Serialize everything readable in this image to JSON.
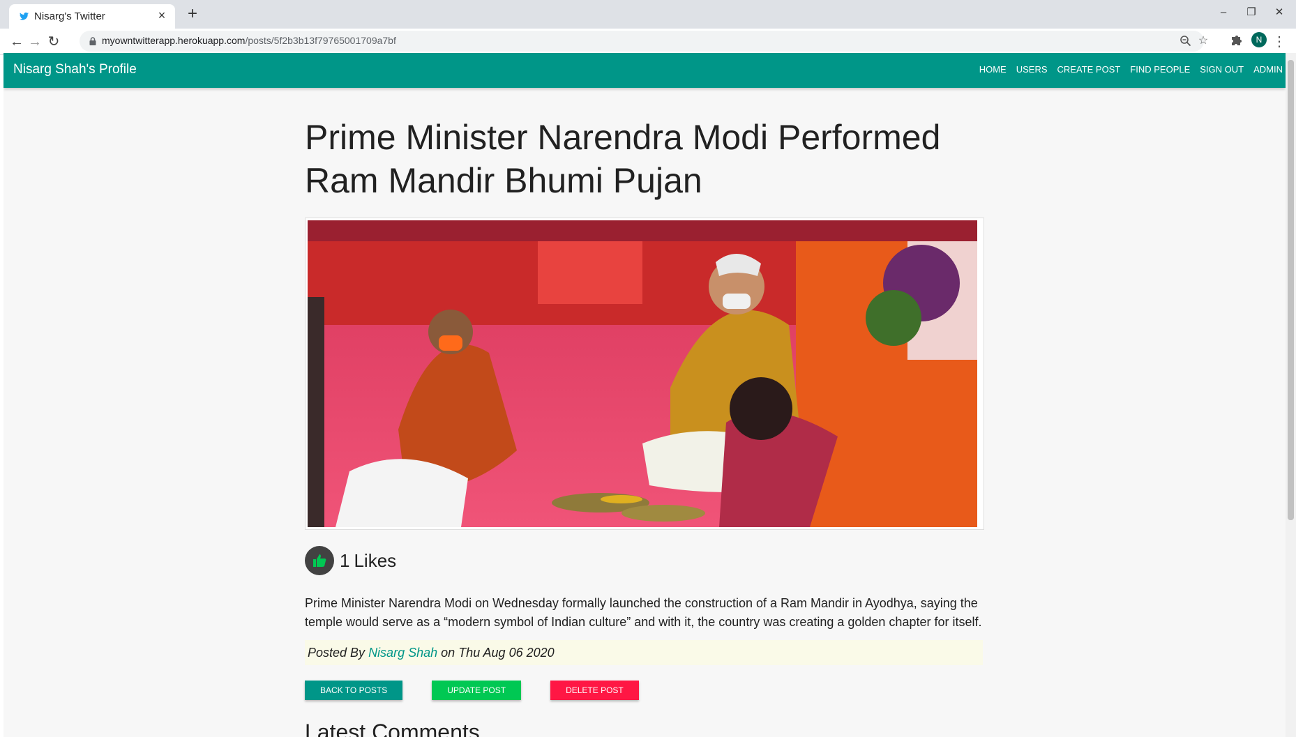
{
  "browser": {
    "tab_title": "Nisarg's Twitter",
    "url_host": "myowntwitterapp.herokuapp.com",
    "url_path": "/posts/5f2b3b13f79765001709a7bf",
    "profile_initial": "N",
    "icons": {
      "favicon": "twitter-bird-icon",
      "close_tab": "×",
      "new_tab": "+",
      "back": "←",
      "forward": "→",
      "reload": "↻",
      "zoom": "magnifier-icon",
      "bookmark": "☆",
      "extensions": "puzzle-icon",
      "menu": "⋮",
      "minimize": "–",
      "restore": "❐",
      "close_window": "✕"
    }
  },
  "navbar": {
    "brand": "Nisarg Shah's Profile",
    "links": [
      "HOME",
      "USERS",
      "CREATE POST",
      "FIND PEOPLE",
      "SIGN OUT",
      "ADMIN"
    ],
    "color": "#009688"
  },
  "post": {
    "title": "Prime Minister Narendra Modi Performed Ram Mandir Bhumi Pujan",
    "likes_count": "1",
    "likes_label": "Likes",
    "body": "Prime Minister Narendra Modi on Wednesday formally launched the construction of a Ram Mandir in Ayodhya, saying the temple would serve as a “modern symbol of Indian culture” and with it, the country was creating a golden chapter for itself.",
    "posted_by_prefix": "Posted By",
    "author": "Nisarg Shah",
    "date_prefix": "on",
    "date": "Thu Aug 06 2020"
  },
  "actions": {
    "back_label": "BACK TO POSTS",
    "update_label": "UPDATE POST",
    "delete_label": "DELETE POST"
  },
  "comments": {
    "heading": "Latest Comments"
  }
}
